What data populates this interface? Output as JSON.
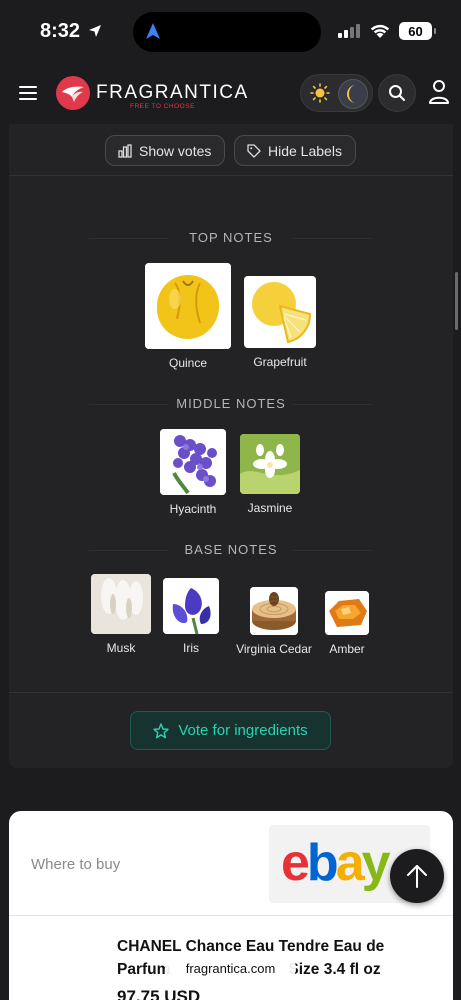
{
  "status_bar": {
    "time": "8:32",
    "battery": "60"
  },
  "header": {
    "brand": "FRAGRANTICA",
    "tagline": "FREE TO CHOOSE"
  },
  "toolbar": {
    "show_votes": "Show votes",
    "hide_labels": "Hide Labels"
  },
  "notes": {
    "top": {
      "title": "TOP NOTES",
      "items": [
        {
          "label": "Quince",
          "icon": "quince-image"
        },
        {
          "label": "Grapefruit",
          "icon": "grapefruit-image"
        }
      ]
    },
    "middle": {
      "title": "MIDDLE NOTES",
      "items": [
        {
          "label": "Hyacinth",
          "icon": "hyacinth-image"
        },
        {
          "label": "Jasmine",
          "icon": "jasmine-image"
        }
      ]
    },
    "base": {
      "title": "BASE NOTES",
      "items": [
        {
          "label": "Musk",
          "icon": "musk-image"
        },
        {
          "label": "Iris",
          "icon": "iris-image"
        },
        {
          "label": "Virginia Cedar",
          "icon": "cedar-image"
        },
        {
          "label": "Amber",
          "icon": "amber-image"
        }
      ]
    },
    "vote_button": "Vote for ingredients"
  },
  "where_to_buy": {
    "label": "Where to buy",
    "store": "ebay",
    "product_title": "CHANEL Chance Eau Tendre Eau de Parfum Spray ... Size 3.4 fl oz",
    "product_title_line1": "CHANEL Chance Eau Tendre Eau de",
    "product_title_line2": "Parfum",
    "product_title_line2_end": "Size 3.4 fl oz",
    "price": "97.75 USD"
  },
  "browser": {
    "url": "fragrantica.com"
  },
  "colors": {
    "background": "#1c1c1e",
    "card": "#232326",
    "accent_teal": "#27d3b2",
    "brand_red": "#e0394b"
  }
}
